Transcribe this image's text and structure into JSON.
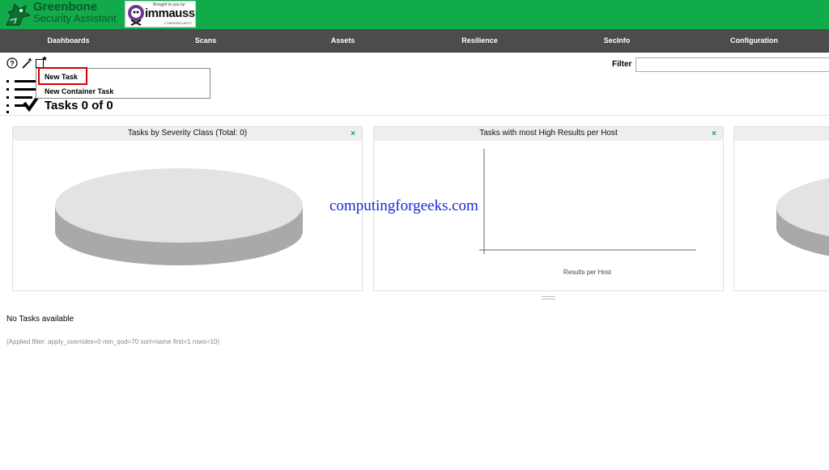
{
  "brand": {
    "line1": "Greenbone",
    "line2": "Security Assistant"
  },
  "sponsor": {
    "tagline": "Brought to you by:",
    "word": "immauss",
    "sub": "CYBERSECURITY"
  },
  "nav": [
    {
      "label": "Dashboards"
    },
    {
      "label": "Scans"
    },
    {
      "label": "Assets"
    },
    {
      "label": "Resilience"
    },
    {
      "label": "SecInfo"
    },
    {
      "label": "Configuration"
    }
  ],
  "toolbar": {
    "help_icon": "help-icon",
    "wizard_icon": "wand-icon",
    "new_icon": "new-star-icon"
  },
  "dropdown": {
    "items": [
      {
        "label": "New Task"
      },
      {
        "label": "New Container Task"
      }
    ]
  },
  "page": {
    "title": "Tasks 0 of 0"
  },
  "filter": {
    "label": "Filter",
    "value": ""
  },
  "panels": [
    {
      "title": "Tasks by Severity Class (Total: 0)",
      "close": "×"
    },
    {
      "title": "Tasks with most High Results per Host",
      "close": "×",
      "xlabel": "Results per Host"
    },
    {
      "title": "",
      "close": ""
    }
  ],
  "watermark": "computingforgeeks.com",
  "content": {
    "empty": "No Tasks available",
    "applied_prefix": "(Applied filter: apply_overrides=0 min_qod=70 ",
    "applied_sort": "sort",
    "applied_suffix": "=name first=1 rows=10)"
  },
  "colors": {
    "header": "#11ab4b",
    "nav": "#4c4c4c",
    "accent": "#11a44a",
    "highlight": "#d40000",
    "watermark": "#1a26d6"
  }
}
